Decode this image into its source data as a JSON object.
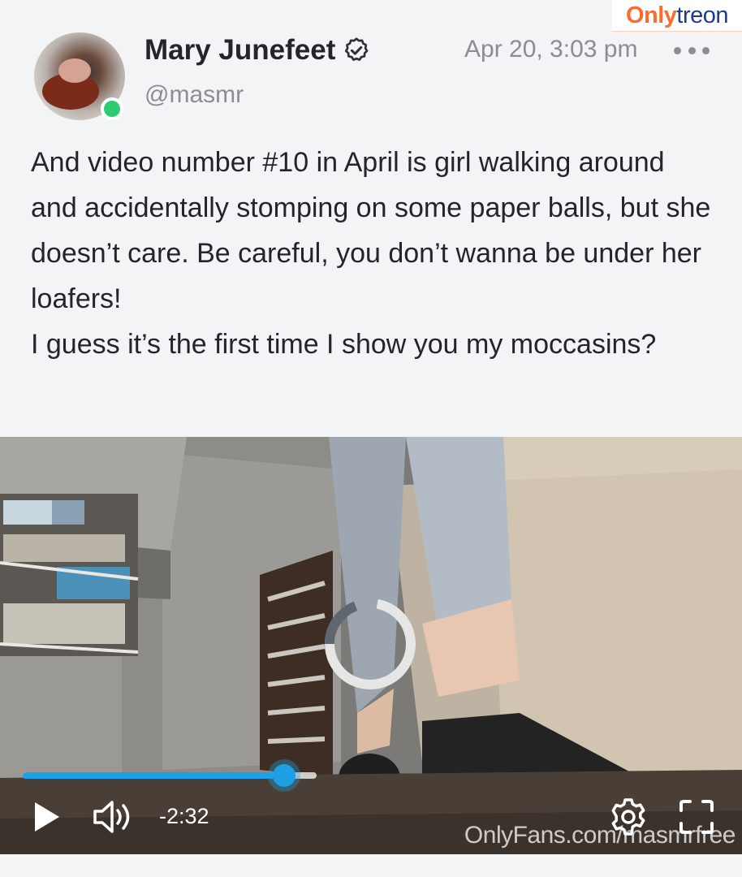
{
  "watermark": {
    "brand_part1": "Only",
    "brand_part2": "treon",
    "bottom_text": "OnlyFans.com/masmrfree"
  },
  "post": {
    "author_name": "Mary Junefeet",
    "handle": "@masmr",
    "timestamp": "Apr 20, 3:03 pm",
    "text_lines": [
      "And video number #10 in April is girl walking around and accidentally stomping on some paper balls, but she doesn’t care. Be careful, you don’t wanna be under her loafers!",
      "I guess it’s the first time I show you my moccasins?"
    ]
  },
  "player": {
    "time_remaining": "-2:32",
    "progress_fraction": 0.89,
    "is_loading": true
  },
  "colors": {
    "accent": "#1ea0e6",
    "online": "#2ecc71",
    "text": "#22262b",
    "muted": "#8a8d92"
  },
  "icons": {
    "verified": "verified-badge-icon",
    "more": "more-horizontal-icon",
    "play": "play-icon",
    "volume": "volume-icon",
    "settings": "gear-icon",
    "fullscreen": "fullscreen-icon",
    "loading": "loading-spinner-icon"
  }
}
